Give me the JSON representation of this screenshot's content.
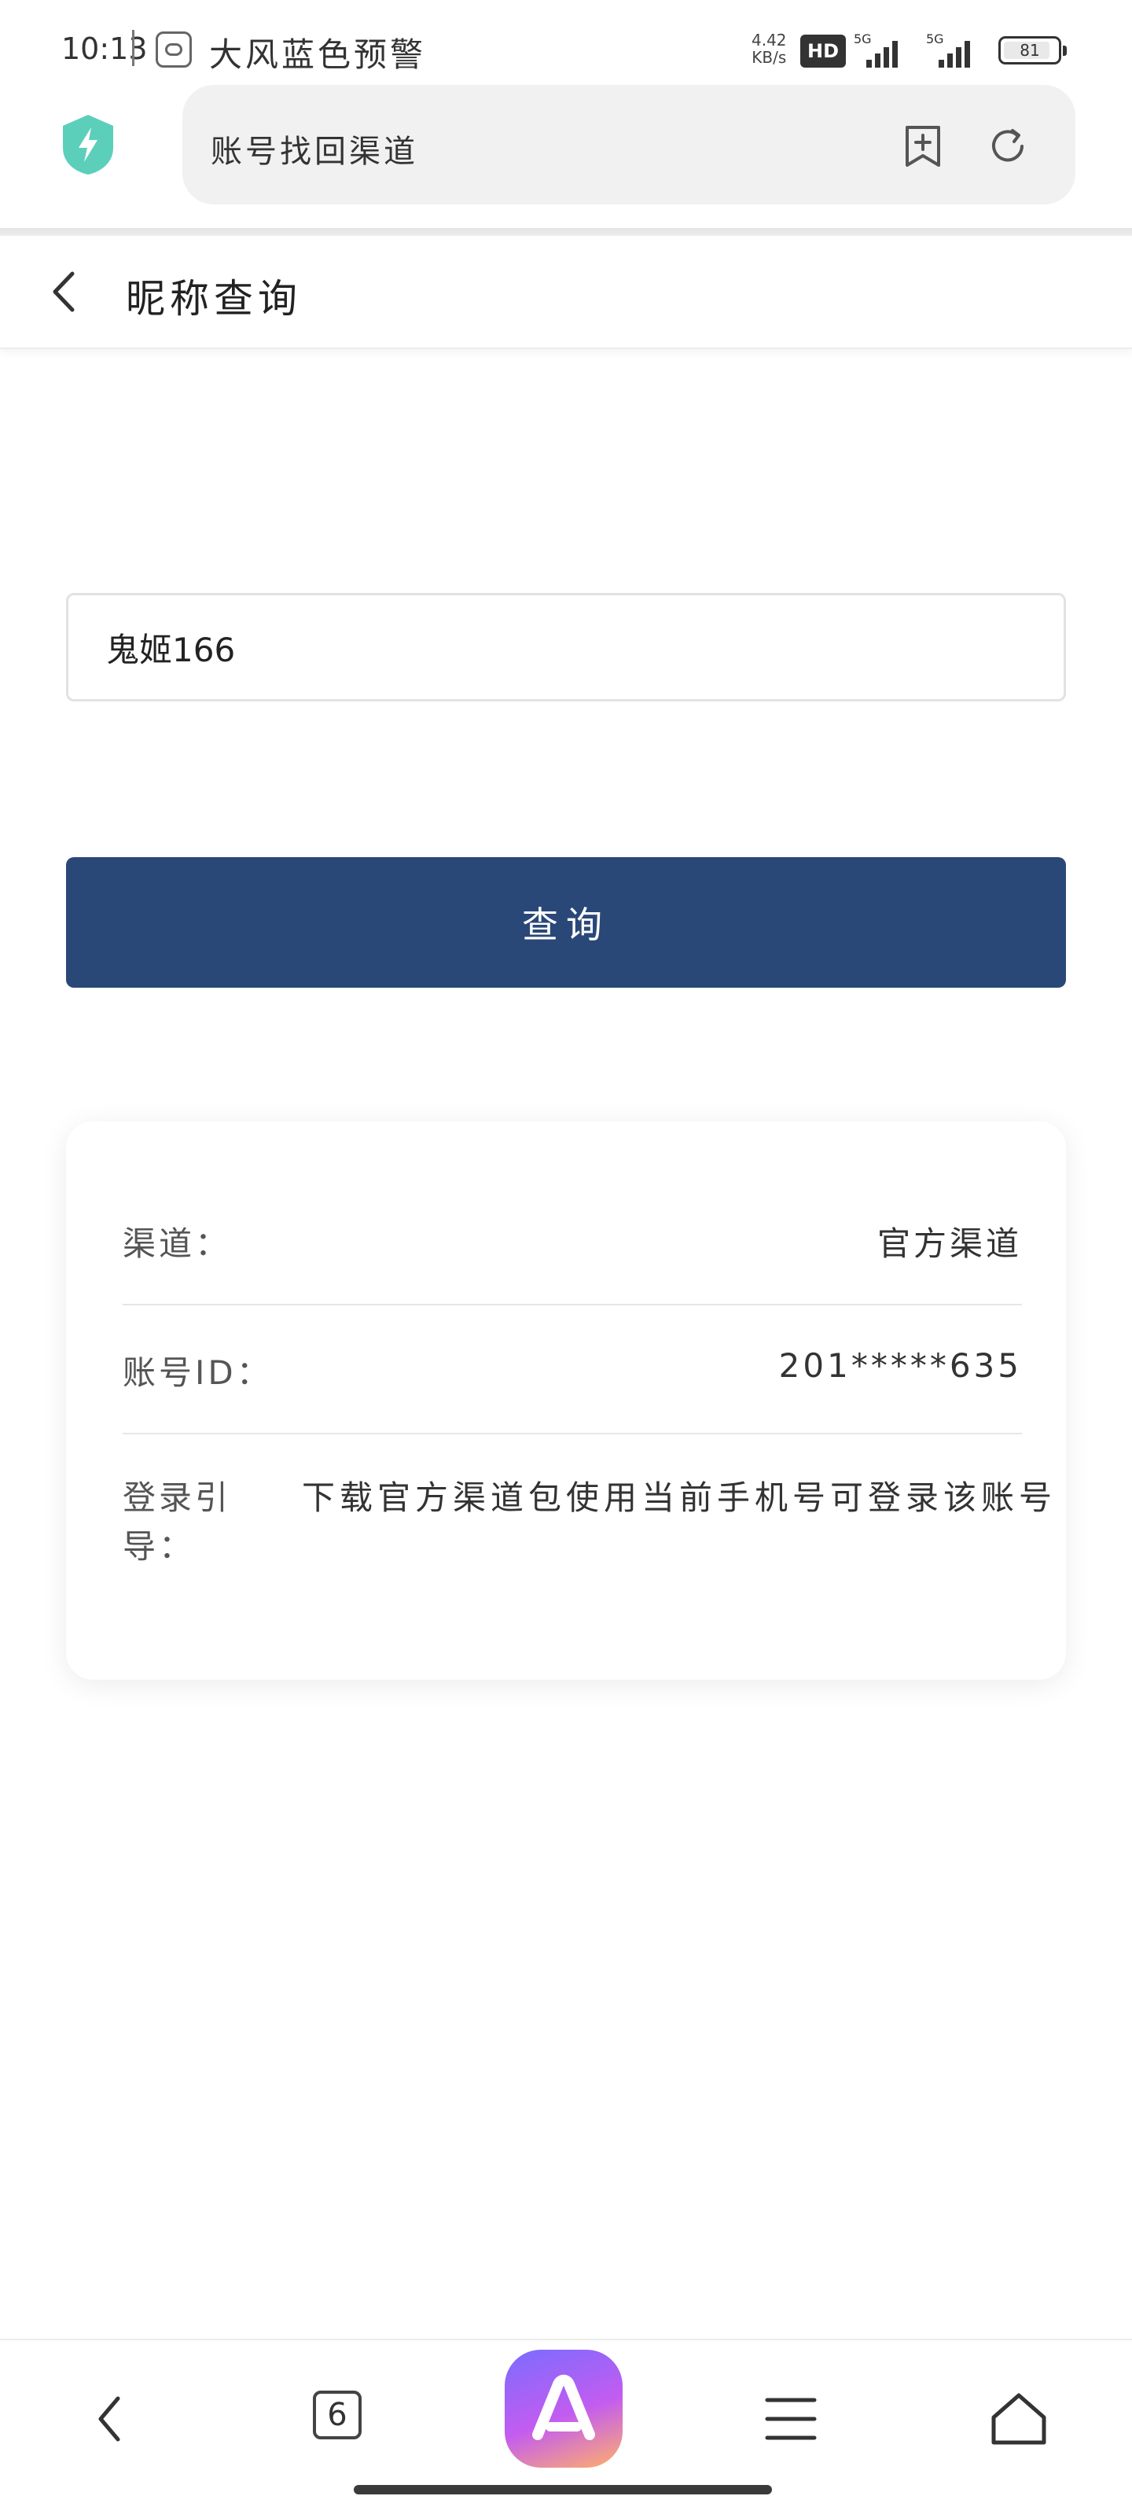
{
  "status_bar": {
    "time": "10:13",
    "alert_text": "大风蓝色预警",
    "net_speed_value": "4.42",
    "net_speed_unit": "KB/s",
    "hd_label": "HD",
    "signal_1_label": "5G",
    "signal_2_label": "5G",
    "battery_level": "81"
  },
  "browser": {
    "url_title": "账号找回渠道"
  },
  "header": {
    "title": "昵称查询"
  },
  "form": {
    "nickname_value": "鬼姬166",
    "query_button": "查询"
  },
  "result": {
    "channel_label": "渠道：",
    "channel_value": "官方渠道",
    "account_label": "账号ID：",
    "account_value": "201*****635",
    "guide_label": "登录引导：",
    "guide_value": "下载官方渠道包使用当前手机号可登录该账号"
  },
  "bottom_nav": {
    "tab_count": "6"
  },
  "colors": {
    "primary_button": "#294878",
    "shield": "#5ccfbb"
  }
}
